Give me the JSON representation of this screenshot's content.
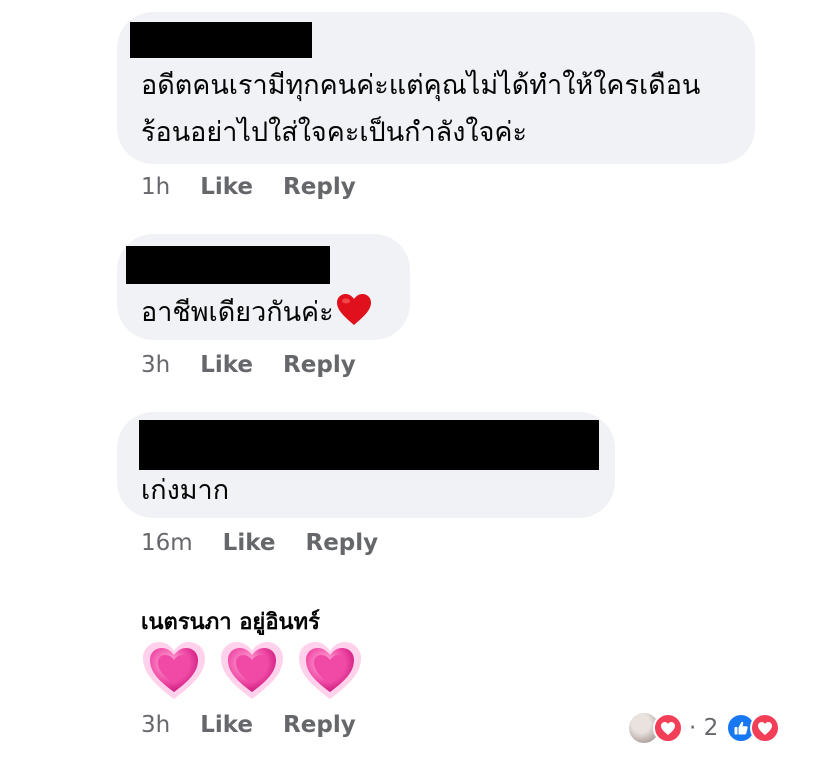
{
  "comments": [
    {
      "lines": [
        "อดีตคนเรามีทุกคนค่ะแต่คุณไม่ได้ทำให้ใครเดือน",
        "ร้อนอย่าไปใส่ใจคะเป็นกำลังใจค่ะ"
      ],
      "time": "1h",
      "like": "Like",
      "reply": "Reply"
    },
    {
      "lines": [
        "อาชีพเดียวกันค่ะ"
      ],
      "emoji": "❤️",
      "time": "3h",
      "like": "Like",
      "reply": "Reply"
    },
    {
      "lines": [
        "เก่งมาก"
      ],
      "time": "16m",
      "like": "Like",
      "reply": "Reply"
    },
    {
      "author": "เนตรนภา อยู่อินทร์",
      "emoji_count": 3,
      "emoji": "pink-heart",
      "time": "3h",
      "like": "Like",
      "reply": "Reply",
      "reactions": {
        "count": "· 2",
        "types": [
          "avatar",
          "love",
          "like",
          "love"
        ]
      }
    }
  ],
  "colors": {
    "bubble": "#f0f2f5",
    "meta": "#65676b",
    "love": "#f33e58",
    "like": "#1877f2",
    "heart_pink": "#f04aa6"
  }
}
